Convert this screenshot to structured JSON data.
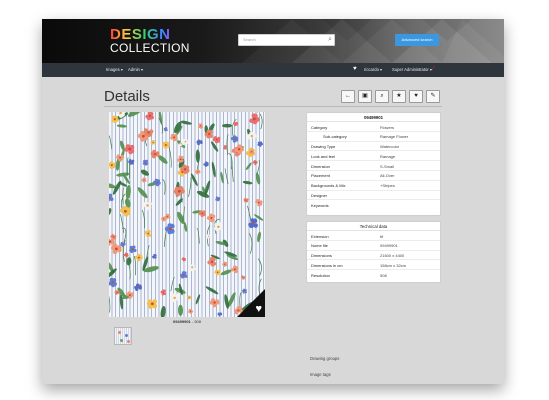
{
  "header": {
    "logo_line1": "DESIGN",
    "logo_line2": "COLLECTION",
    "search_placeholder": "Search",
    "search_icon": "search-icon",
    "advanced_search_label": "Advanced search"
  },
  "navbar": {
    "images_label": "Images ▾",
    "admin_label": "Admin ▾",
    "favorites_icon": "heart-icon",
    "user_label": "riccardo ▾",
    "role_label": "Super Administrator ▾",
    "pin_icon": "pin-icon"
  },
  "page": {
    "title": "Details"
  },
  "toolbar": {
    "buttons": [
      {
        "icon": "back-arrow-icon",
        "glyph": "←"
      },
      {
        "icon": "image-icon",
        "glyph": "▣"
      },
      {
        "icon": "zoom-icon",
        "glyph": "⌕"
      },
      {
        "icon": "star-icon",
        "glyph": "★"
      },
      {
        "icon": "heart-icon",
        "glyph": "♥"
      },
      {
        "icon": "wrench-icon",
        "glyph": "✎"
      }
    ]
  },
  "image": {
    "caption_code": "09499901",
    "caption_rest": " - 508",
    "favorite_icon": "heart-icon",
    "favorite_glyph": "♥"
  },
  "details_table": {
    "heading": "09499901",
    "rows": [
      {
        "key": "Category",
        "value": "Flowers"
      },
      {
        "key": "Sub-category",
        "value": "Ramage Flower"
      },
      {
        "key": "Drawing Type",
        "value": "Watercolor"
      },
      {
        "key": "Look and feel",
        "value": "Ramage"
      },
      {
        "key": "Dimension",
        "value": "S-Small"
      },
      {
        "key": "Placement",
        "value": "All-Over"
      },
      {
        "key": "Backgrounds & Mix",
        "value": "+Stripes"
      },
      {
        "key": "Designer",
        "value": ""
      },
      {
        "key": "Keywords",
        "value": ""
      }
    ]
  },
  "technical_table": {
    "heading": "Technical data",
    "rows": [
      {
        "key": "Extension",
        "value": "tif"
      },
      {
        "key": "Nome file",
        "value": "09499901"
      },
      {
        "key": "Dimensions",
        "value": "21600 x 4400"
      },
      {
        "key": "Dimensions in cm",
        "value": "158cm x 32cm"
      },
      {
        "key": "Resolution",
        "value": "508"
      }
    ]
  },
  "footer": {
    "drawing_groups": "Drawing groups",
    "image_tags": "Image tags"
  },
  "colors": {
    "accent": "#3a97e0",
    "navbar": "#2f353c",
    "page_bg": "#d8d8d8"
  }
}
